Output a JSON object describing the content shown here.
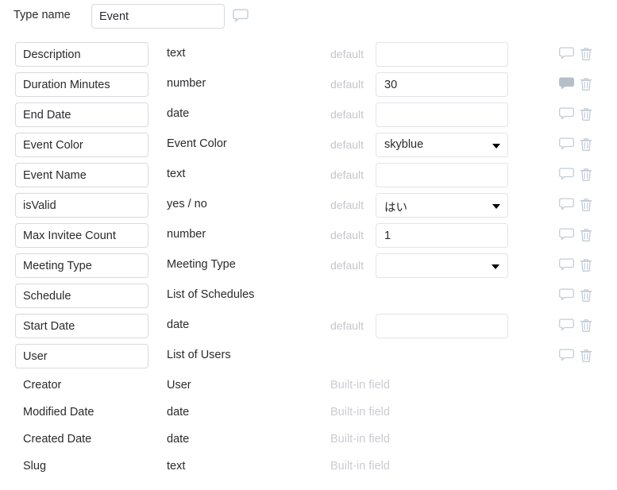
{
  "header": {
    "type_name_label": "Type name",
    "type_name_value": "Event",
    "comment_icon": "speech-bubble-outline-icon"
  },
  "labels": {
    "default_label": "default",
    "builtin_label": "Built-in field",
    "comment_icon": "speech-bubble-outline-icon",
    "comment_icon_filled": "speech-bubble-filled-icon",
    "trash_icon": "trash-icon",
    "caret_icon": "caret-down-icon"
  },
  "fields": [
    {
      "name": "Description",
      "type": "text",
      "default_kind": "input",
      "default_value": "",
      "has_default": true,
      "comment_filled": false
    },
    {
      "name": "Duration Minutes",
      "type": "number",
      "default_kind": "input",
      "default_value": "30",
      "has_default": true,
      "comment_filled": true
    },
    {
      "name": "End Date",
      "type": "date",
      "default_kind": "input",
      "default_value": "",
      "has_default": true,
      "comment_filled": false
    },
    {
      "name": "Event Color",
      "type": "Event Color",
      "default_kind": "select",
      "default_value": "skyblue",
      "has_default": true,
      "comment_filled": false
    },
    {
      "name": "Event Name",
      "type": "text",
      "default_kind": "input",
      "default_value": "",
      "has_default": true,
      "comment_filled": false
    },
    {
      "name": "isValid",
      "type": "yes / no",
      "default_kind": "select",
      "default_value": "はい",
      "has_default": true,
      "comment_filled": false
    },
    {
      "name": "Max Invitee Count",
      "type": "number",
      "default_kind": "input",
      "default_value": "1",
      "has_default": true,
      "comment_filled": false
    },
    {
      "name": "Meeting Type",
      "type": "Meeting Type",
      "default_kind": "select-narrow",
      "default_value": "",
      "has_default": true,
      "comment_filled": false
    },
    {
      "name": "Schedule",
      "type": "List of Schedules",
      "default_kind": "none",
      "default_value": "",
      "has_default": false,
      "comment_filled": false
    },
    {
      "name": "Start Date",
      "type": "date",
      "default_kind": "input",
      "default_value": "",
      "has_default": true,
      "comment_filled": false
    },
    {
      "name": "User",
      "type": "List of Users",
      "default_kind": "none",
      "default_value": "",
      "has_default": false,
      "comment_filled": false
    }
  ],
  "builtin_fields": [
    {
      "name": "Creator",
      "type": "User",
      "note": "Built-in field"
    },
    {
      "name": "Modified Date",
      "type": "date",
      "note": "Built-in field"
    },
    {
      "name": "Created Date",
      "type": "date",
      "note": "Built-in field"
    },
    {
      "name": "Slug",
      "type": "text",
      "note": "Built-in field"
    }
  ],
  "colors": {
    "text": "#2a2a2e",
    "muted": "#c4c6cb",
    "icon": "#c3ccd6",
    "icon_filled": "#aab6c2",
    "border": "#d8dade",
    "border_light": "#e2e4e8",
    "background": "#ffffff"
  }
}
